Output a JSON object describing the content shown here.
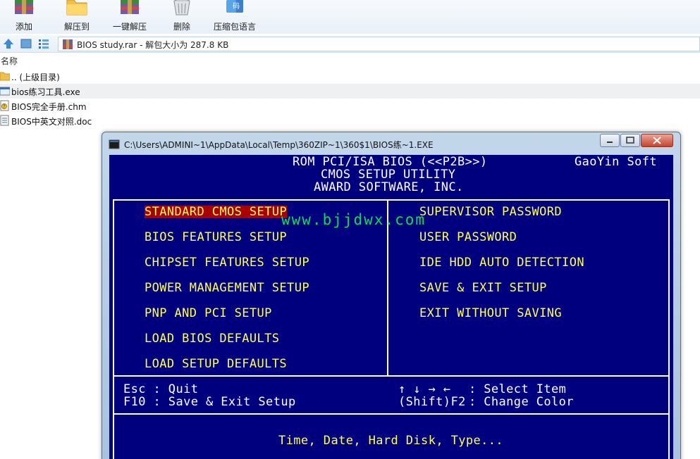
{
  "toolbar": {
    "buttons": [
      {
        "label": "添加",
        "icon": "add-archive-icon"
      },
      {
        "label": "解压到",
        "icon": "extract-folder-icon"
      },
      {
        "label": "一键解压",
        "icon": "one-click-extract-icon"
      },
      {
        "label": "删除",
        "icon": "trash-bin-icon"
      },
      {
        "label": "压缩包语言",
        "icon": "archive-language-icon"
      }
    ]
  },
  "address": {
    "path": "BIOS study.rar - 解包大小为 287.8 KB"
  },
  "file_list": {
    "header": "名称",
    "items": [
      {
        "name": ".. (上级目录)",
        "icon": "folder-up-icon"
      },
      {
        "name": "bios练习工具.exe",
        "icon": "exe-file-icon"
      },
      {
        "name": "BIOS完全手册.chm",
        "icon": "chm-file-icon"
      },
      {
        "name": "BIOS中英文对照.doc",
        "icon": "doc-file-icon"
      }
    ]
  },
  "console": {
    "title": "C:\\Users\\ADMINI~1\\AppData\\Local\\Temp\\360ZIP~1\\360$1\\BIOS练~1.EXE"
  },
  "bios": {
    "header_line1": "ROM PCI/ISA BIOS (<<P2B>>)",
    "header_line2": "CMOS SETUP UTILITY",
    "header_line3": "AWARD SOFTWARE, INC.",
    "brand": "GaoYin Soft",
    "watermark": "www.bjjdwx.com",
    "left_menu": [
      "STANDARD CMOS SETUP",
      "BIOS FEATURES SETUP",
      "CHIPSET FEATURES SETUP",
      "POWER MANAGEMENT SETUP",
      "PNP AND PCI SETUP",
      "LOAD BIOS DEFAULTS",
      "LOAD SETUP DEFAULTS"
    ],
    "right_menu": [
      "SUPERVISOR PASSWORD",
      "USER PASSWORD",
      "IDE HDD AUTO DETECTION",
      "SAVE & EXIT SETUP",
      "EXIT WITHOUT SAVING"
    ],
    "selected_index": 0,
    "help_left_1": "Esc : Quit",
    "help_left_2": "F10 : Save & Exit Setup",
    "help_right_keys_1": "↑ ↓ → ←",
    "help_right_desc_1": ": Select Item",
    "help_right_keys_2": "(Shift)F2",
    "help_right_desc_2": ": Change Color",
    "description": "Time, Date, Hard Disk, Type..."
  }
}
